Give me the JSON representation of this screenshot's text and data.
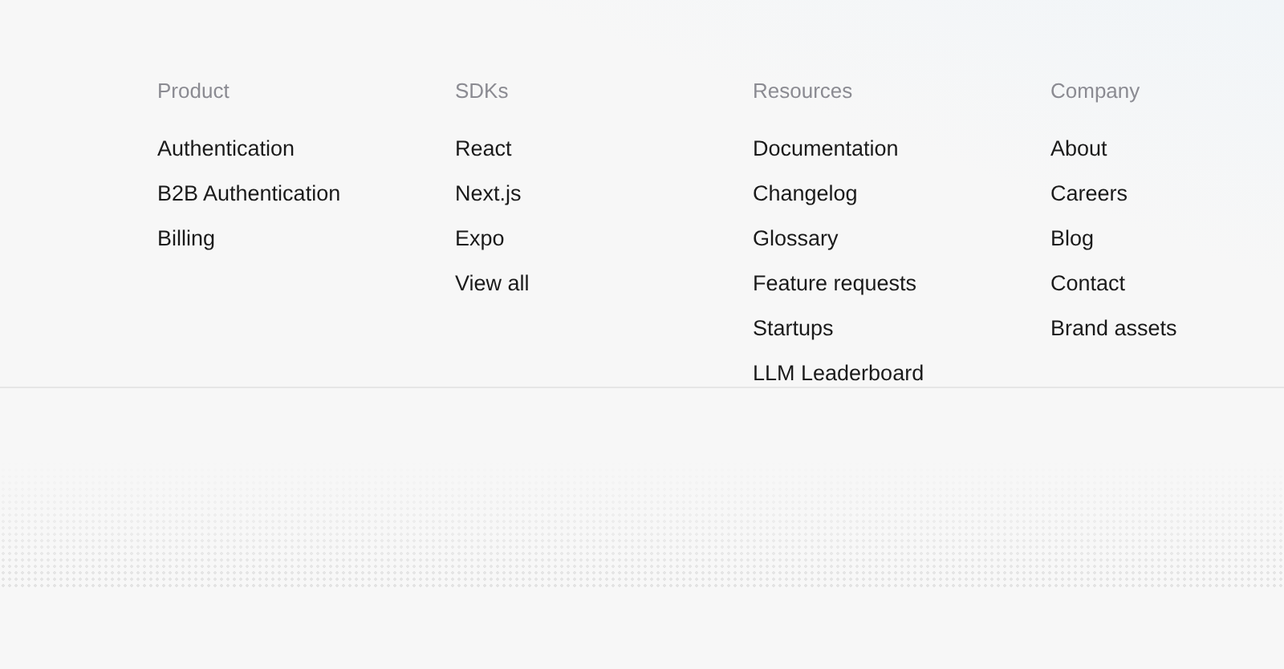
{
  "columns": [
    {
      "heading": "Product",
      "links": [
        "Authentication",
        "B2B Authentication",
        "Billing"
      ]
    },
    {
      "heading": "SDKs",
      "links": [
        "React",
        "Next.js",
        "Expo",
        "View all"
      ]
    },
    {
      "heading": "Resources",
      "links": [
        "Documentation",
        "Changelog",
        "Glossary",
        "Feature requests",
        "Startups",
        "LLM Leaderboard"
      ]
    },
    {
      "heading": "Company",
      "links": [
        "About",
        "Careers",
        "Blog",
        "Contact",
        "Brand assets"
      ]
    }
  ]
}
